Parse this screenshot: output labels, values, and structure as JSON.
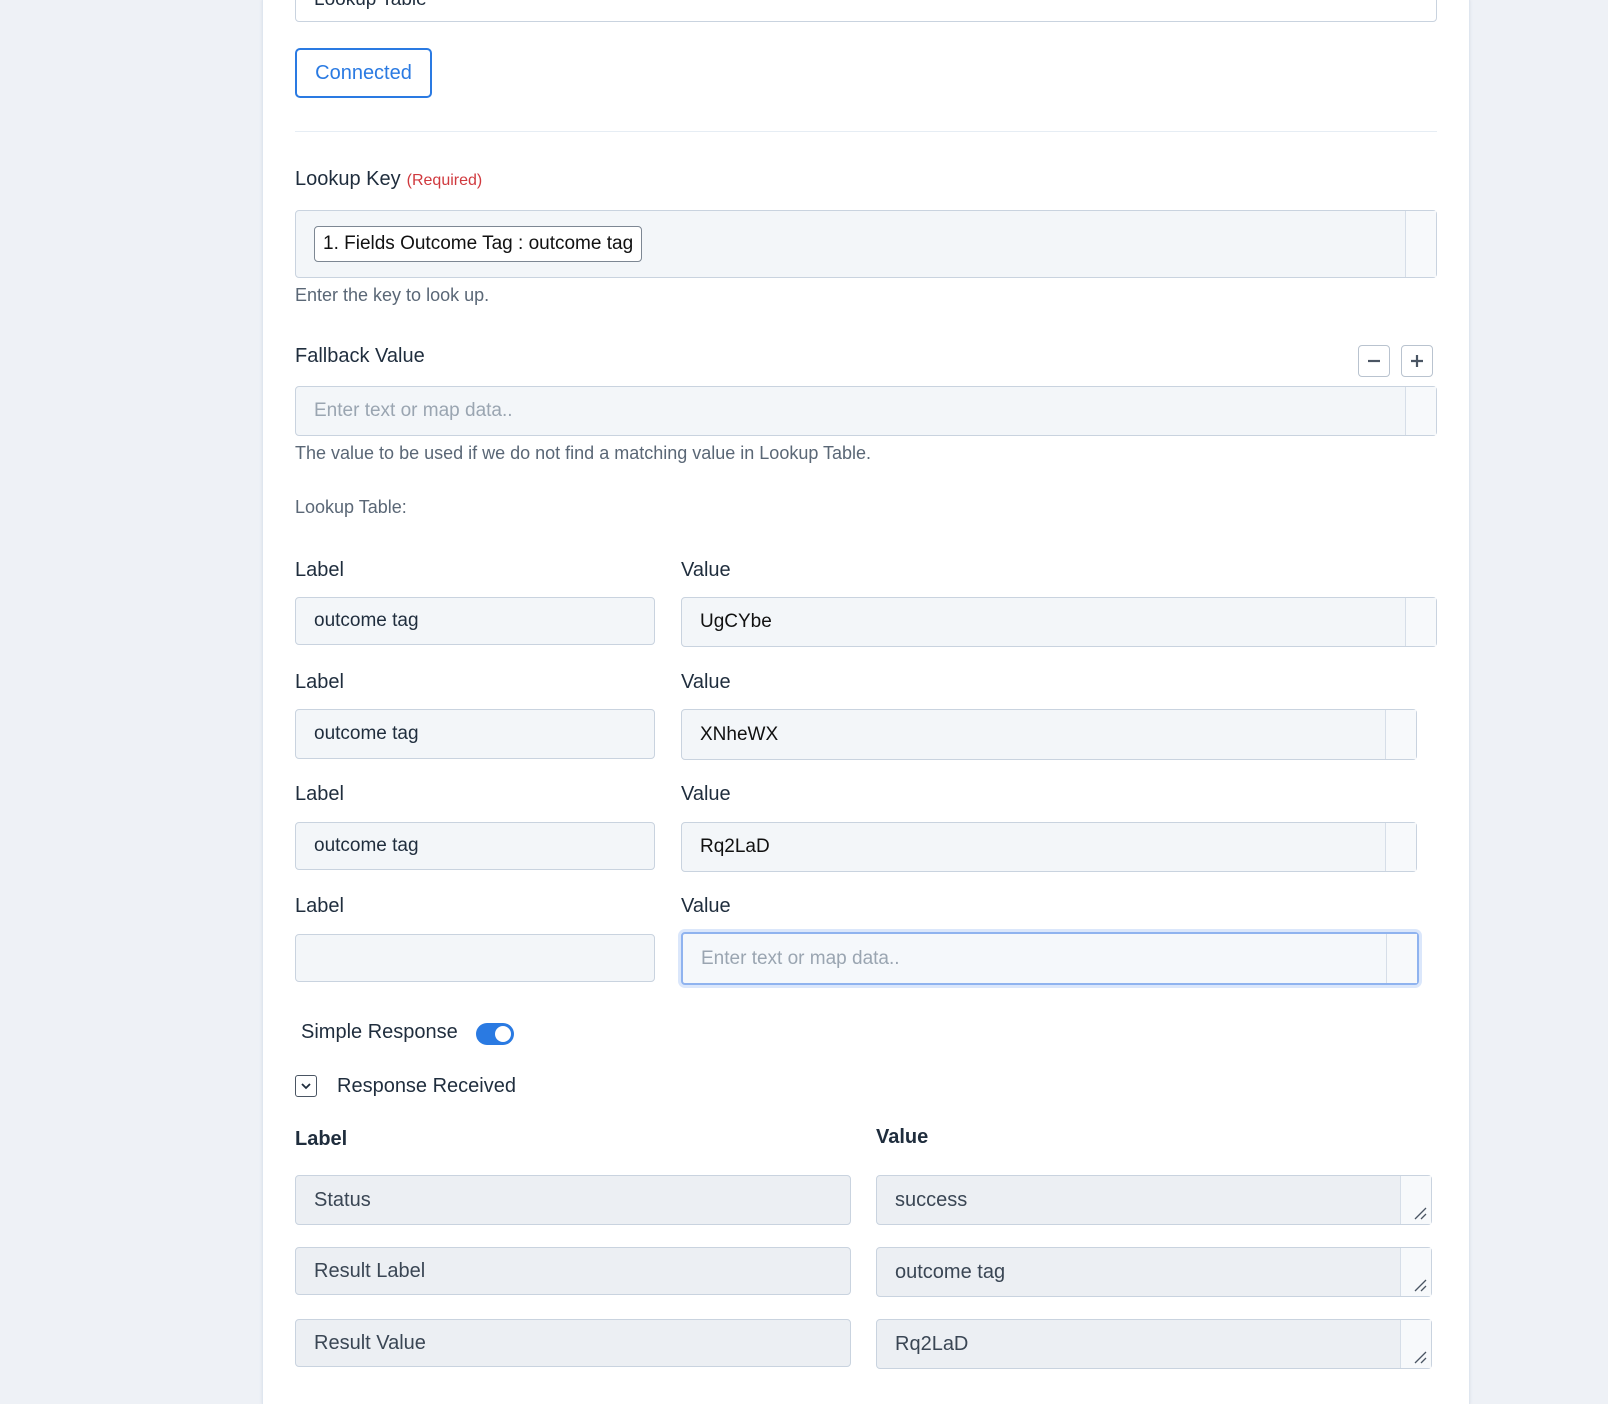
{
  "top_select": {
    "value": "Lookup Table"
  },
  "connected_label": "Connected",
  "lookup_key": {
    "label": "Lookup Key",
    "required": "(Required)",
    "tag": "1. Fields Outcome Tag : outcome tag",
    "help": "Enter the key to look up."
  },
  "fallback": {
    "label": "Fallback Value",
    "placeholder": "Enter text or map data..",
    "help": "The value to be used if we do not find a matching value in Lookup Table."
  },
  "lookup_table": {
    "title": "Lookup Table:",
    "label_header": "Label",
    "value_header": "Value",
    "rows": [
      {
        "label": "outcome tag",
        "value": "UgCYbe"
      },
      {
        "label": "outcome tag",
        "value": "XNheWX"
      },
      {
        "label": "outcome tag",
        "value": "Rq2LaD"
      },
      {
        "label": "",
        "value": ""
      }
    ],
    "placeholder": "Enter text or map data.."
  },
  "simple_response": {
    "label": "Simple Response",
    "on": true
  },
  "response": {
    "title": "Response Received",
    "label_header": "Label",
    "value_header": "Value",
    "rows": [
      {
        "label": "Status",
        "value": "success"
      },
      {
        "label": "Result Label",
        "value": "outcome tag"
      },
      {
        "label": "Result Value",
        "value": "Rq2LaD"
      }
    ]
  },
  "colors": {
    "accent": "#2a7ae2",
    "required": "#d0393e"
  }
}
